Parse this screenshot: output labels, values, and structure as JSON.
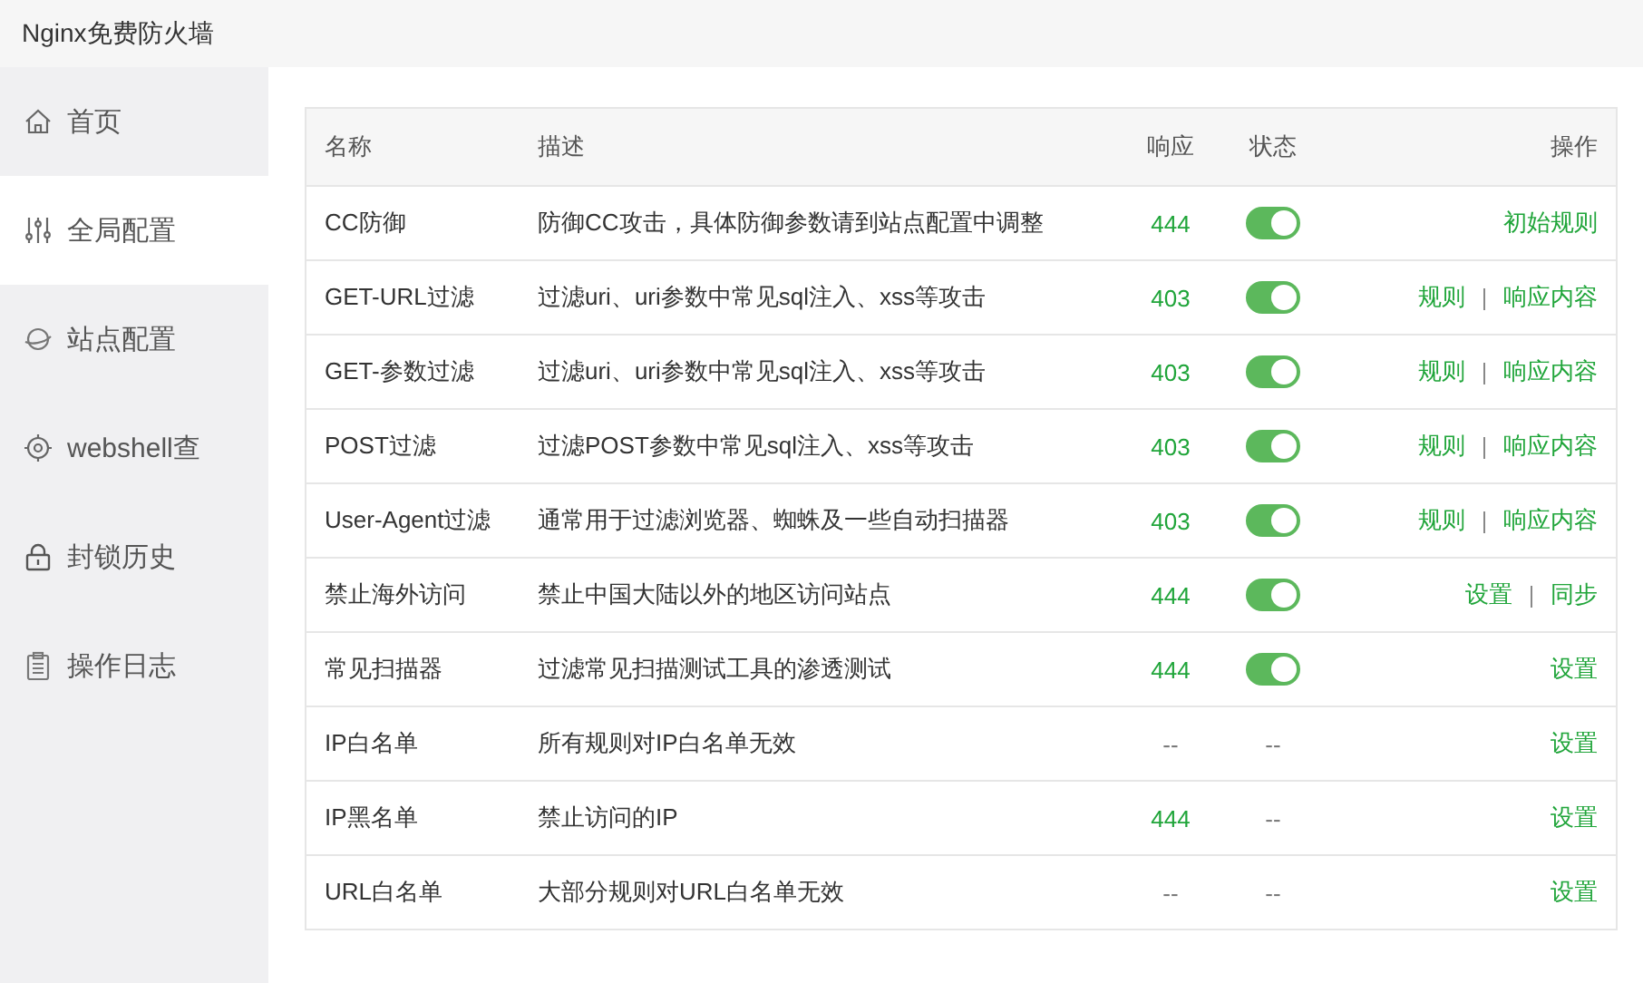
{
  "window": {
    "title": "Nginx免费防火墙"
  },
  "sidebar": {
    "items": [
      {
        "label": "首页",
        "selected": false
      },
      {
        "label": "全局配置",
        "selected": true
      },
      {
        "label": "站点配置",
        "selected": false
      },
      {
        "label": "webshell查",
        "selected": false
      },
      {
        "label": "封锁历史",
        "selected": false
      },
      {
        "label": "操作日志",
        "selected": false
      }
    ]
  },
  "table": {
    "columns": [
      "名称",
      "描述",
      "响应",
      "状态",
      "操作"
    ],
    "rows": [
      {
        "name": "CC防御",
        "description": "防御CC攻击，具体防御参数请到站点配置中调整",
        "response": {
          "text": "444",
          "active": true
        },
        "status": {
          "kind": "toggle",
          "on": true
        },
        "actions": [
          "初始规则"
        ]
      },
      {
        "name": "GET-URL过滤",
        "description": "过滤uri、uri参数中常见sql注入、xss等攻击",
        "response": {
          "text": "403",
          "active": true
        },
        "status": {
          "kind": "toggle",
          "on": true
        },
        "actions": [
          "规则",
          "响应内容"
        ]
      },
      {
        "name": "GET-参数过滤",
        "description": "过滤uri、uri参数中常见sql注入、xss等攻击",
        "response": {
          "text": "403",
          "active": true
        },
        "status": {
          "kind": "toggle",
          "on": true
        },
        "actions": [
          "规则",
          "响应内容"
        ]
      },
      {
        "name": "POST过滤",
        "description": "过滤POST参数中常见sql注入、xss等攻击",
        "response": {
          "text": "403",
          "active": true
        },
        "status": {
          "kind": "toggle",
          "on": true
        },
        "actions": [
          "规则",
          "响应内容"
        ]
      },
      {
        "name": "User-Agent过滤",
        "description": "通常用于过滤浏览器、蜘蛛及一些自动扫描器",
        "response": {
          "text": "403",
          "active": true
        },
        "status": {
          "kind": "toggle",
          "on": true
        },
        "actions": [
          "规则",
          "响应内容"
        ]
      },
      {
        "name": "禁止海外访问",
        "description": "禁止中国大陆以外的地区访问站点",
        "response": {
          "text": "444",
          "active": true
        },
        "status": {
          "kind": "toggle",
          "on": true
        },
        "actions": [
          "设置",
          "同步"
        ]
      },
      {
        "name": "常见扫描器",
        "description": "过滤常见扫描测试工具的渗透测试",
        "response": {
          "text": "444",
          "active": true
        },
        "status": {
          "kind": "toggle",
          "on": true
        },
        "actions": [
          "设置"
        ]
      },
      {
        "name": "IP白名单",
        "description": "所有规则对IP白名单无效",
        "response": {
          "text": "--",
          "active": false
        },
        "status": {
          "kind": "text",
          "text": "--"
        },
        "actions": [
          "设置"
        ]
      },
      {
        "name": "IP黑名单",
        "description": "禁止访问的IP",
        "response": {
          "text": "444",
          "active": true
        },
        "status": {
          "kind": "text",
          "text": "--"
        },
        "actions": [
          "设置"
        ]
      },
      {
        "name": "URL白名单",
        "description": "大部分规则对URL白名单无效",
        "response": {
          "text": "--",
          "active": false
        },
        "status": {
          "kind": "text",
          "text": "--"
        },
        "actions": [
          "设置"
        ]
      }
    ]
  }
}
